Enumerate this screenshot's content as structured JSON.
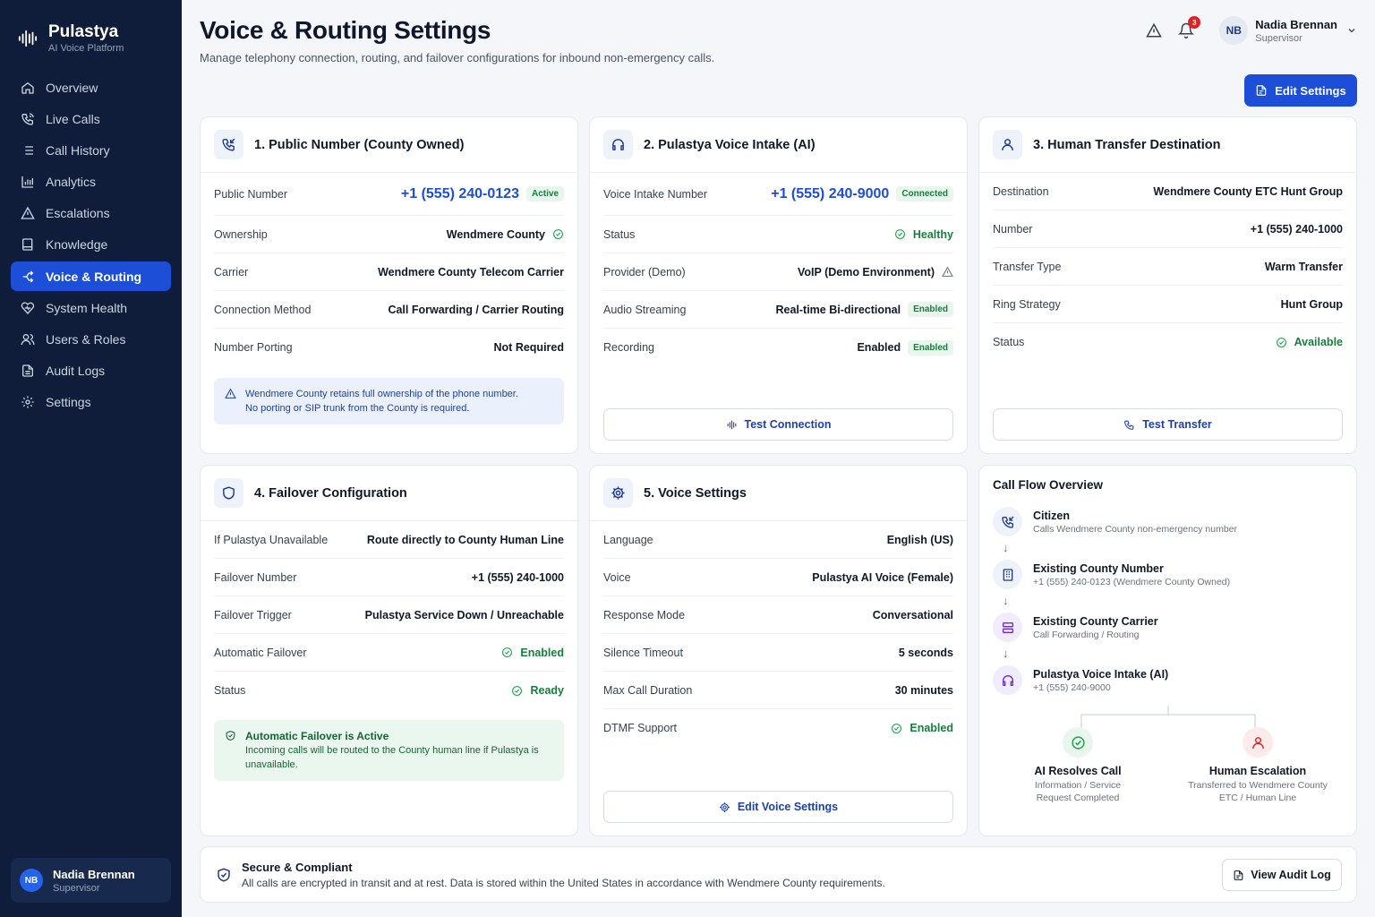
{
  "brand": {
    "name": "Pulastya",
    "subtitle": "AI Voice Platform"
  },
  "nav": [
    {
      "label": "Overview",
      "icon": "home-icon"
    },
    {
      "label": "Live Calls",
      "icon": "phone-call-icon"
    },
    {
      "label": "Call History",
      "icon": "list-icon"
    },
    {
      "label": "Analytics",
      "icon": "bar-chart-icon"
    },
    {
      "label": "Escalations",
      "icon": "warning-icon"
    },
    {
      "label": "Knowledge",
      "icon": "book-icon"
    },
    {
      "label": "Voice & Routing",
      "icon": "routing-icon",
      "active": true
    },
    {
      "label": "System Health",
      "icon": "heart-pulse-icon"
    },
    {
      "label": "Users & Roles",
      "icon": "users-icon"
    },
    {
      "label": "Audit Logs",
      "icon": "file-icon"
    },
    {
      "label": "Settings",
      "icon": "gear-icon"
    }
  ],
  "user": {
    "initials": "NB",
    "name": "Nadia Brennan",
    "role": "Supervisor"
  },
  "header": {
    "title": "Voice & Routing Settings",
    "subtitle": "Manage telephony connection, routing, and failover configurations for inbound non-emergency calls.",
    "notification_count": "3",
    "edit_label": "Edit Settings"
  },
  "cards": {
    "public": {
      "title": "1. Public Number (County Owned)",
      "rows": [
        {
          "label": "Public Number",
          "value": "+1 (555) 240-0123",
          "badge": "Active"
        },
        {
          "label": "Ownership",
          "value": "Wendmere County"
        },
        {
          "label": "Carrier",
          "value": "Wendmere County Telecom Carrier"
        },
        {
          "label": "Connection Method",
          "value": "Call Forwarding / Carrier Routing"
        },
        {
          "label": "Number Porting",
          "value": "Not Required"
        }
      ],
      "note_line1": "Wendmere County retains full ownership of the phone number.",
      "note_line2": "No porting or SIP trunk from the County is required."
    },
    "intake": {
      "title": "2. Pulastya Voice Intake (AI)",
      "rows": [
        {
          "label": "Voice Intake Number",
          "value": "+1 (555) 240-9000",
          "badge": "Connected"
        },
        {
          "label": "Status",
          "value": "Healthy"
        },
        {
          "label": "Provider (Demo)",
          "value": "VoIP (Demo Environment)"
        },
        {
          "label": "Audio Streaming",
          "value": "Real-time Bi-directional",
          "badge": "Enabled"
        },
        {
          "label": "Recording",
          "value": "Enabled",
          "badge": "Enabled"
        }
      ],
      "button": "Test Connection"
    },
    "transfer": {
      "title": "3. Human Transfer Destination",
      "rows": [
        {
          "label": "Destination",
          "value": "Wendmere County ETC Hunt Group"
        },
        {
          "label": "Number",
          "value": "+1 (555) 240-1000"
        },
        {
          "label": "Transfer Type",
          "value": "Warm Transfer"
        },
        {
          "label": "Ring Strategy",
          "value": "Hunt Group"
        },
        {
          "label": "Status",
          "value": "Available"
        }
      ],
      "button": "Test Transfer"
    },
    "failover": {
      "title": "4. Failover Configuration",
      "rows": [
        {
          "label": "If Pulastya Unavailable",
          "value": "Route directly to County Human Line"
        },
        {
          "label": "Failover Number",
          "value": "+1 (555) 240-1000"
        },
        {
          "label": "Failover Trigger",
          "value": "Pulastya Service Down / Unreachable"
        },
        {
          "label": "Automatic Failover",
          "value": "Enabled"
        },
        {
          "label": "Status",
          "value": "Ready"
        }
      ],
      "note_title": "Automatic Failover is Active",
      "note_text": "Incoming calls will be routed to the County human line if Pulastya is unavailable."
    },
    "voice": {
      "title": "5. Voice Settings",
      "rows": [
        {
          "label": "Language",
          "value": "English (US)"
        },
        {
          "label": "Voice",
          "value": "Pulastya AI Voice (Female)"
        },
        {
          "label": "Response Mode",
          "value": "Conversational"
        },
        {
          "label": "Silence Timeout",
          "value": "5 seconds"
        },
        {
          "label": "Max Call Duration",
          "value": "30 minutes"
        },
        {
          "label": "DTMF Support",
          "value": "Enabled"
        }
      ],
      "button": "Edit Voice Settings"
    }
  },
  "flow": {
    "title": "Call Flow Overview",
    "steps": [
      {
        "title": "Citizen",
        "sub": "Calls Wendmere County non-emergency number"
      },
      {
        "title": "Existing County Number",
        "sub": "+1 (555) 240-0123 (Wendmere County Owned)"
      },
      {
        "title": "Existing County Carrier",
        "sub": "Call Forwarding / Routing"
      },
      {
        "title": "Pulastya Voice Intake (AI)",
        "sub": "+1 (555) 240-9000"
      }
    ],
    "branches": [
      {
        "title": "AI Resolves Call",
        "sub1": "Information / Service",
        "sub2": "Request Completed"
      },
      {
        "title": "Human Escalation",
        "sub1": "Transferred to Wendmere County",
        "sub2": "ETC / Human Line"
      }
    ]
  },
  "footer": {
    "title": "Secure & Compliant",
    "text": "All calls are encrypted in transit and at rest. Data is stored within the United States in accordance with Wendmere County requirements.",
    "button": "View Audit Log"
  },
  "colors": {
    "sidebar": "#0f1d3a",
    "accent": "#1d4ed8",
    "success": "#15803d"
  }
}
